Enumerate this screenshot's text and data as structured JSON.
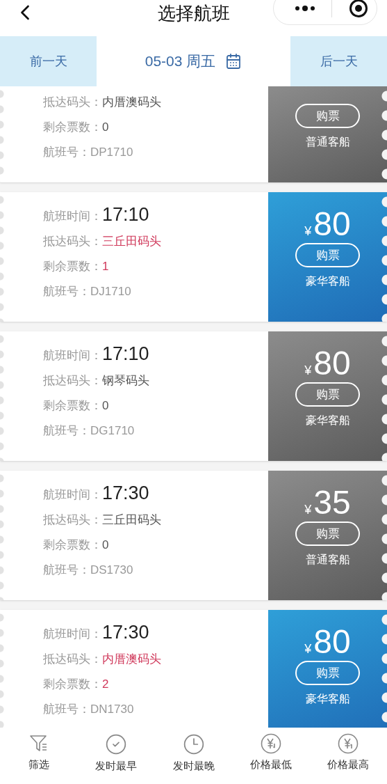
{
  "header": {
    "title": "选择航班"
  },
  "date_bar": {
    "prev": "前一天",
    "date": "05-03 周五",
    "next": "后一天"
  },
  "flights": [
    {
      "available": false,
      "fields": [
        {
          "kind": "arrival",
          "label": "抵达码头：",
          "value": "内厝澳码头"
        },
        {
          "kind": "remaining",
          "label": "剩余票数：",
          "value": "0"
        },
        {
          "kind": "flight",
          "label": "航班号：",
          "value": "DP1710"
        }
      ],
      "buy": "购票",
      "ship": "普通客船"
    },
    {
      "available": true,
      "fields": [
        {
          "kind": "time",
          "label": "航班时间：",
          "value": "17:10"
        },
        {
          "kind": "arrival",
          "label": "抵达码头：",
          "value": "三丘田码头"
        },
        {
          "kind": "remaining",
          "label": "剩余票数：",
          "value": "1"
        },
        {
          "kind": "flight",
          "label": "航班号：",
          "value": "DJ1710"
        }
      ],
      "price": {
        "currency": "¥",
        "amount": "80"
      },
      "buy": "购票",
      "ship": "豪华客船"
    },
    {
      "available": false,
      "fields": [
        {
          "kind": "time",
          "label": "航班时间：",
          "value": "17:10"
        },
        {
          "kind": "arrival",
          "label": "抵达码头：",
          "value": "钢琴码头"
        },
        {
          "kind": "remaining",
          "label": "剩余票数：",
          "value": "0"
        },
        {
          "kind": "flight",
          "label": "航班号：",
          "value": "DG1710"
        }
      ],
      "price": {
        "currency": "¥",
        "amount": "80"
      },
      "buy": "购票",
      "ship": "豪华客船"
    },
    {
      "available": false,
      "fields": [
        {
          "kind": "time",
          "label": "航班时间：",
          "value": "17:30"
        },
        {
          "kind": "arrival",
          "label": "抵达码头：",
          "value": "三丘田码头"
        },
        {
          "kind": "remaining",
          "label": "剩余票数：",
          "value": "0"
        },
        {
          "kind": "flight",
          "label": "航班号：",
          "value": "DS1730"
        }
      ],
      "price": {
        "currency": "¥",
        "amount": "35"
      },
      "buy": "购票",
      "ship": "普通客船"
    },
    {
      "available": true,
      "fields": [
        {
          "kind": "time",
          "label": "航班时间：",
          "value": "17:30"
        },
        {
          "kind": "arrival",
          "label": "抵达码头：",
          "value": "内厝澳码头"
        },
        {
          "kind": "remaining",
          "label": "剩余票数：",
          "value": "2"
        },
        {
          "kind": "flight",
          "label": "航班号：",
          "value": "DN1730"
        }
      ],
      "price": {
        "currency": "¥",
        "amount": "80"
      },
      "buy": "购票",
      "ship": "豪华客船"
    }
  ],
  "sort_bar": [
    {
      "kind": "filter",
      "label": "筛选"
    },
    {
      "kind": "earliest",
      "label": "发时最早"
    },
    {
      "kind": "latest",
      "label": "发时最晚"
    },
    {
      "kind": "lowest",
      "label": "价格最低"
    },
    {
      "kind": "highest",
      "label": "价格最高"
    }
  ]
}
